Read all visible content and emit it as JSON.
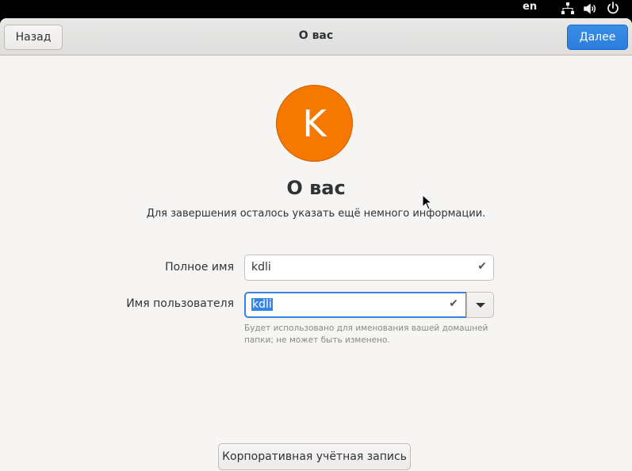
{
  "system_bar": {
    "language": "en",
    "icons": [
      "network-icon",
      "volume-icon",
      "power-icon"
    ]
  },
  "header": {
    "back_label": "Назад",
    "title": "О вас",
    "next_label": "Далее"
  },
  "avatar": {
    "letter": "K",
    "color": "#f57900"
  },
  "main": {
    "title": "О вас",
    "subtitle": "Для завершения осталось указать ещё немного информации."
  },
  "form": {
    "full_name_label": "Полное имя",
    "full_name_value": "kdli",
    "username_label": "Имя пользователя",
    "username_value": "kdli",
    "username_hint": "Будет использовано для именования вашей домашней папки; не может быть изменено."
  },
  "enterprise_button_label": "Корпоративная учётная запись",
  "colors": {
    "accent": "#3584e4",
    "avatar": "#f57900"
  }
}
